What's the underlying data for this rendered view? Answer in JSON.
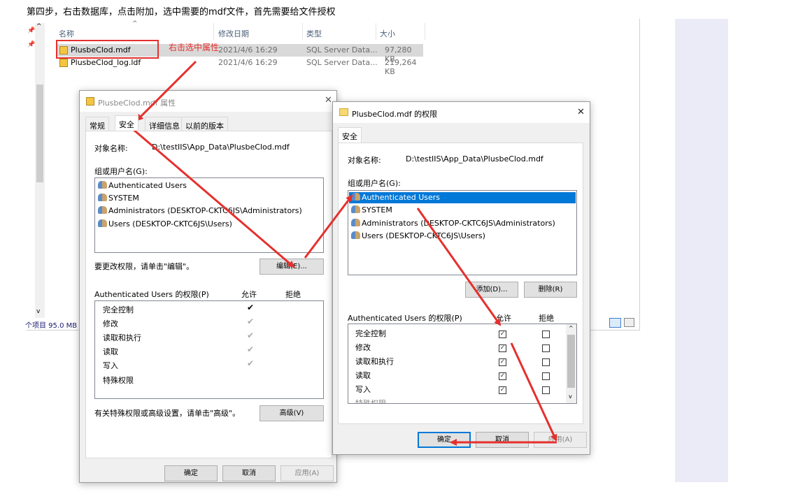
{
  "caption": "第四步，右击数据库，点击附加，选中需要的mdf文件，首先需要给文件授权",
  "explorer": {
    "columns": {
      "name": "名称",
      "date": "修改日期",
      "type": "类型",
      "size": "大小"
    },
    "files": [
      {
        "name": "PlusbeClod.mdf",
        "date": "2021/4/6 16:29",
        "type": "SQL Server Data...",
        "size": "97,280 KB"
      },
      {
        "name": "PlusbeClod_log.ldf",
        "date": "2021/4/6 16:29",
        "type": "SQL Server Data...",
        "size": "219,264 KB"
      }
    ],
    "status": "个项目 95.0 MB",
    "annotation": "右击选中属性"
  },
  "props": {
    "title": "PlusbeClod.mdf 属性",
    "tabs": [
      "常规",
      "安全",
      "详细信息",
      "以前的版本"
    ],
    "object_label": "对象名称:",
    "object_value": "D:\\testIIS\\App_Data\\PlusbeClod.mdf",
    "group_label": "组或用户名(G):",
    "users": [
      "Authenticated Users",
      "SYSTEM",
      "Administrators (DESKTOP-CKTC6JS\\Administrators)",
      "Users (DESKTOP-CKTC6JS\\Users)"
    ],
    "change_hint": "要更改权限，请单击\"编辑\"。",
    "edit_button": "编辑(E)...",
    "perm_label": "Authenticated Users 的权限(P)",
    "allow": "允许",
    "deny": "拒绝",
    "perms": [
      "完全控制",
      "修改",
      "读取和执行",
      "读取",
      "写入",
      "特殊权限"
    ],
    "advanced_hint": "有关特殊权限或高级设置，请单击\"高级\"。",
    "advanced_button": "高级(V)",
    "ok": "确定",
    "cancel": "取消",
    "apply": "应用(A)"
  },
  "perm": {
    "title": "PlusbeClod.mdf 的权限",
    "tab": "安全",
    "object_label": "对象名称:",
    "object_value": "D:\\testIIS\\App_Data\\PlusbeClod.mdf",
    "group_label": "组或用户名(G):",
    "users": [
      "Authenticated Users",
      "SYSTEM",
      "Administrators (DESKTOP-CKTC6JS\\Administrators)",
      "Users (DESKTOP-CKTC6JS\\Users)"
    ],
    "add_button": "添加(D)...",
    "remove_button": "删除(R)",
    "perm_label": "Authenticated Users 的权限(P)",
    "allow": "允许",
    "deny": "拒绝",
    "perms": [
      "完全控制",
      "修改",
      "读取和执行",
      "读取",
      "写入",
      "特殊权限"
    ],
    "ok": "确定",
    "cancel": "取消",
    "apply": "应用(A)"
  }
}
